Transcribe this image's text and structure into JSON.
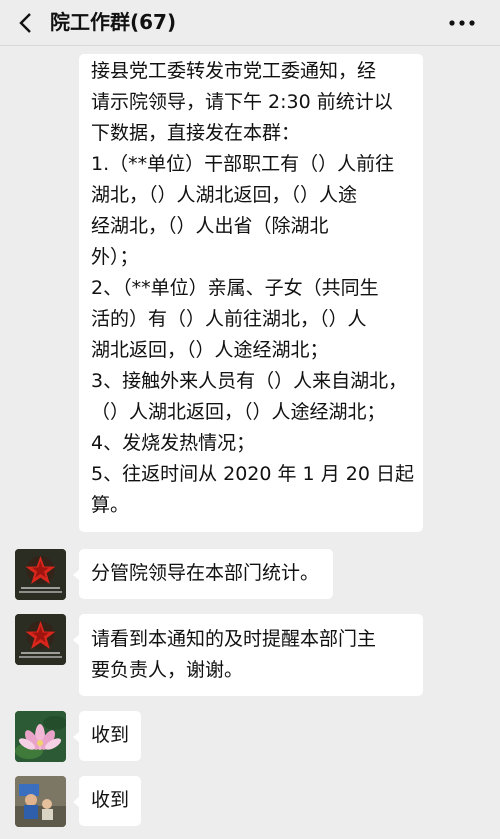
{
  "header": {
    "title": "院工作群(67)",
    "back_icon": "chevron-left-icon",
    "more_icon": "more-dots-icon"
  },
  "messages": [
    {
      "lines": [
        "接县党工委转发市党工委通知，经",
        "请示院领导，请下午 2:30 前统计以",
        "下数据，直接发在本群：",
        "1.（**单位）干部职工有（）人前往",
        "湖北，（）人湖北返回，（）人途",
        "经湖北，（）人出省（除湖北",
        "外）；",
        "2、（**单位）亲属、子女（共同生",
        "活的）有（）人前往湖北，（）人",
        "湖北返回，（）人途经湖北；",
        "3、接触外来人员有（）人来自湖北，",
        "（）人湖北返回，（）人途经湖北；",
        "4、发烧发热情况；",
        "5、往返时间从 2020 年 1 月 20 日起",
        "算。"
      ]
    },
    {
      "lines": [
        "分管院领导在本部门统计。"
      ],
      "avatar": "red-star-avatar"
    },
    {
      "lines": [
        "请看到本通知的及时提醒本部门主",
        "要负责人，谢谢。"
      ],
      "avatar": "red-star-avatar"
    },
    {
      "lines": [
        "收到"
      ],
      "avatar": "lotus-flower-avatar"
    },
    {
      "lines": [
        "收到"
      ],
      "avatar": "child-photo-avatar"
    }
  ]
}
